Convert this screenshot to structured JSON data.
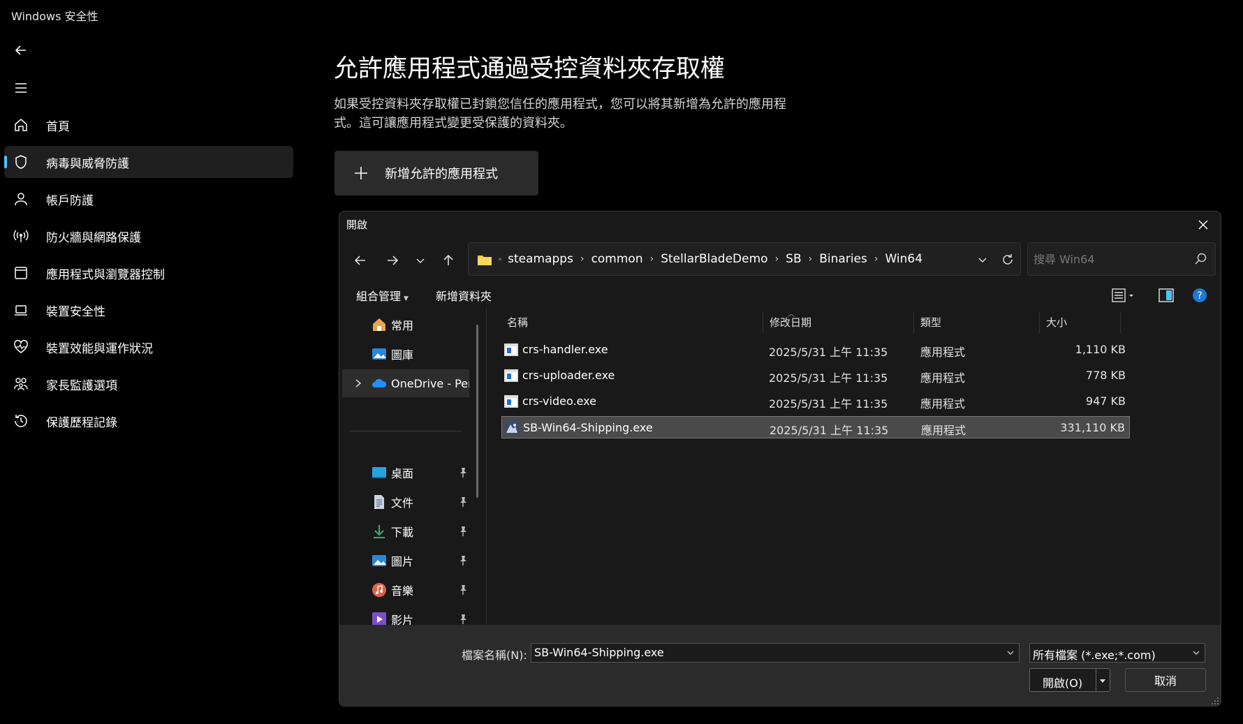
{
  "window": {
    "title": "Windows 安全性"
  },
  "sidebar": {
    "items": [
      {
        "label": "首頁",
        "icon": "home-icon"
      },
      {
        "label": "病毒與威脅防護",
        "icon": "shield-icon",
        "active": true
      },
      {
        "label": "帳戶防護",
        "icon": "person-icon"
      },
      {
        "label": "防火牆與網路保護",
        "icon": "wireless-icon"
      },
      {
        "label": "應用程式與瀏覽器控制",
        "icon": "app-window-icon"
      },
      {
        "label": "裝置安全性",
        "icon": "laptop-icon"
      },
      {
        "label": "裝置效能與運作狀況",
        "icon": "heart-pulse-icon"
      },
      {
        "label": "家長監護選項",
        "icon": "family-icon"
      },
      {
        "label": "保護歷程記錄",
        "icon": "history-icon"
      }
    ]
  },
  "main": {
    "title": "允許應用程式通過受控資料夾存取權",
    "description": "如果受控資料夾存取權已封鎖您信任的應用程式，您可以將其新增為允許的應用程式。這可讓應用程式變更受保護的資料夾。",
    "add_button_label": "新增允許的應用程式"
  },
  "dialog": {
    "title": "開啟",
    "breadcrumb": [
      "steamapps",
      "common",
      "StellarBladeDemo",
      "SB",
      "Binaries",
      "Win64"
    ],
    "search_placeholder": "搜尋 Win64",
    "commands": {
      "organize": "組合管理",
      "new_folder": "新增資料夾"
    },
    "nav_items": [
      {
        "label": "常用",
        "icon": "home-icon"
      },
      {
        "label": "圖庫",
        "icon": "gallery-icon"
      },
      {
        "label": "OneDrive - Pers",
        "icon": "cloud-icon",
        "expandable": true,
        "highlighted": true
      },
      {
        "label": "桌面",
        "icon": "desktop-icon",
        "pinned": true
      },
      {
        "label": "文件",
        "icon": "document-icon",
        "pinned": true
      },
      {
        "label": "下載",
        "icon": "download-icon",
        "pinned": true
      },
      {
        "label": "圖片",
        "icon": "pictures-icon",
        "pinned": true
      },
      {
        "label": "音樂",
        "icon": "music-icon",
        "pinned": true
      },
      {
        "label": "影片",
        "icon": "video-icon",
        "pinned": true
      }
    ],
    "columns": {
      "name": "名稱",
      "date": "修改日期",
      "type": "類型",
      "size": "大小"
    },
    "files": [
      {
        "name": "crs-handler.exe",
        "date": "2025/5/31 上午 11:35",
        "type": "應用程式",
        "size": "1,110 KB"
      },
      {
        "name": "crs-uploader.exe",
        "date": "2025/5/31 上午 11:35",
        "type": "應用程式",
        "size": "778 KB"
      },
      {
        "name": "crs-video.exe",
        "date": "2025/5/31 上午 11:35",
        "type": "應用程式",
        "size": "947 KB"
      },
      {
        "name": "SB-Win64-Shipping.exe",
        "date": "2025/5/31 上午 11:35",
        "type": "應用程式",
        "size": "331,110 KB",
        "selected": true
      }
    ],
    "filename_label": "檔案名稱(N):",
    "filename_value": "SB-Win64-Shipping.exe",
    "filetype_value": "所有檔案 (*.exe;*.com)",
    "open_label": "開啟(O)",
    "cancel_label": "取消"
  },
  "colors": {
    "accent": "#4cc2ff",
    "background": "#000000",
    "dialog_bg": "#191919",
    "selected_row": "#4a4a4a"
  }
}
